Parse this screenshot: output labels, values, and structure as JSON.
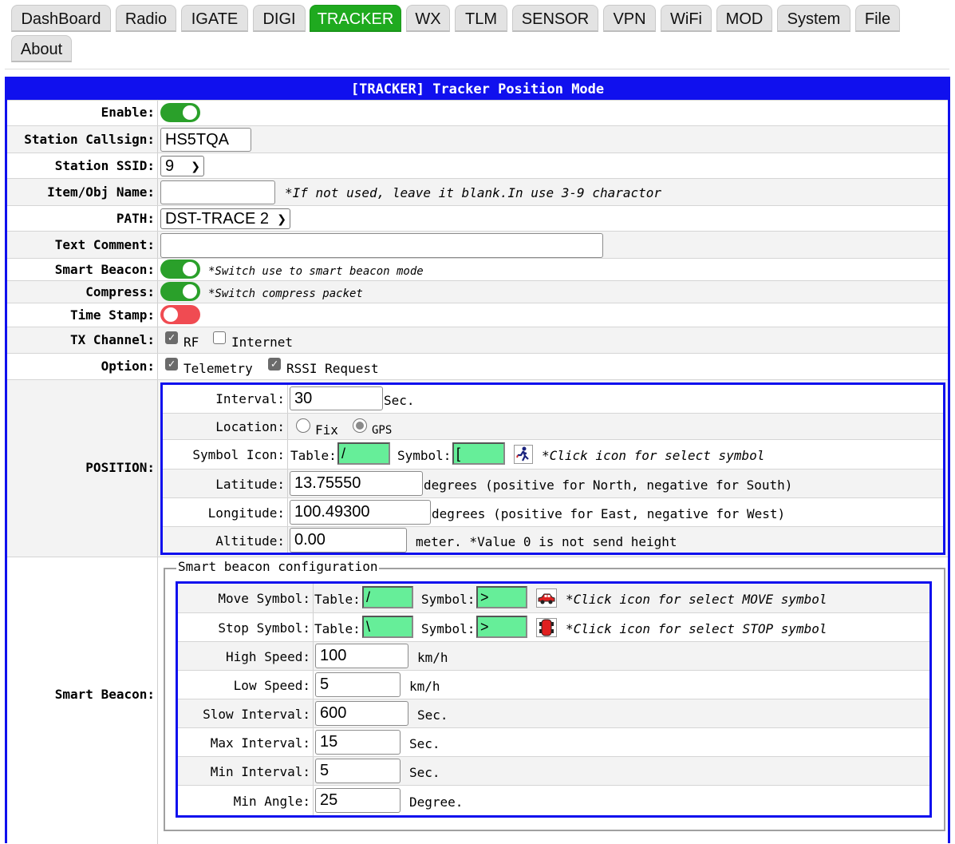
{
  "nav": {
    "tabs": [
      "DashBoard",
      "Radio",
      "IGATE",
      "DIGI",
      "TRACKER",
      "WX",
      "TLM",
      "SENSOR",
      "VPN",
      "WiFi",
      "MOD",
      "System",
      "File",
      "About"
    ],
    "active": "TRACKER"
  },
  "form": {
    "title": "[TRACKER] Tracker Position Mode",
    "enable_label": "Enable:",
    "enable": true,
    "callsign_label": "Station Callsign:",
    "callsign": "HS5TQA",
    "ssid_label": "Station SSID:",
    "ssid": "9",
    "item_label": "Item/Obj Name:",
    "item_value": "",
    "item_note": "*If not used, leave it blank.In use 3-9 charactor",
    "path_label": "PATH:",
    "path": "DST-TRACE 2",
    "comment_label": "Text Comment:",
    "comment_value": "",
    "smart_label": "Smart Beacon:",
    "smart_beacon": true,
    "smart_note": "*Switch use to smart beacon mode",
    "compress_label": "Compress:",
    "compress": true,
    "compress_note": "*Switch compress packet",
    "timestamp_label": "Time Stamp:",
    "timestamp": false,
    "tx_label": "TX Channel:",
    "tx_rf_label": "RF",
    "tx_rf": true,
    "tx_inet_label": "Internet",
    "tx_inet": false,
    "option_label": "Option:",
    "opt_tlm_label": "Telemetry",
    "opt_tlm": true,
    "opt_rssi_label": "RSSI Request",
    "opt_rssi": true
  },
  "position": {
    "section_label": "POSITION:",
    "interval_label": "Interval:",
    "interval": "30",
    "interval_unit": "Sec.",
    "location_label": "Location:",
    "loc_fix_label": "Fix",
    "loc_gps_label": "GPS",
    "location": "GPS",
    "symbol_label": "Symbol Icon:",
    "table_label": "Table:",
    "table": "/",
    "sym_label": "Symbol:",
    "symbol": "[",
    "symbol_icon": "jogger-icon",
    "symbol_note": "*Click icon for select symbol",
    "lat_label": "Latitude:",
    "latitude": "13.75550",
    "lat_note": "degrees (positive for North, negative for South)",
    "lon_label": "Longitude:",
    "longitude": "100.49300",
    "lon_note": "degrees (positive for East, negative for West)",
    "alt_label": "Altitude:",
    "altitude": "0.00",
    "alt_note": "meter. *Value 0 is not send height"
  },
  "smart": {
    "section_label": "Smart Beacon:",
    "legend": "Smart beacon configuration",
    "move_label": "Move Symbol:",
    "move_table_label": "Table:",
    "move_table": "/",
    "move_sym_label": "Symbol:",
    "move_symbol": ">",
    "move_icon": "car-icon",
    "move_note": "*Click icon for select MOVE symbol",
    "stop_label": "Stop Symbol:",
    "stop_table_label": "Table:",
    "stop_table": "\\",
    "stop_sym_label": "Symbol:",
    "stop_symbol": ">",
    "stop_icon": "car-topview-icon",
    "stop_note": "*Click icon for select STOP symbol",
    "high_label": "High Speed:",
    "high": "100",
    "high_unit": "km/h",
    "low_label": "Low Speed:",
    "low": "5",
    "low_unit": "km/h",
    "slow_label": "Slow Interval:",
    "slow": "600",
    "slow_unit": "Sec.",
    "max_label": "Max Interval:",
    "max": "15",
    "max_unit": "Sec.",
    "min_label": "Min Interval:",
    "min": "5",
    "min_unit": "Sec.",
    "angle_label": "Min Angle:",
    "angle": "25",
    "angle_unit": "Degree."
  },
  "colors": {
    "accent": "#1010ee",
    "active_tab": "#1faa1f",
    "toggle_on": "#2aa02a",
    "toggle_off": "#f04b52",
    "symbol_bg": "#66ee99"
  }
}
